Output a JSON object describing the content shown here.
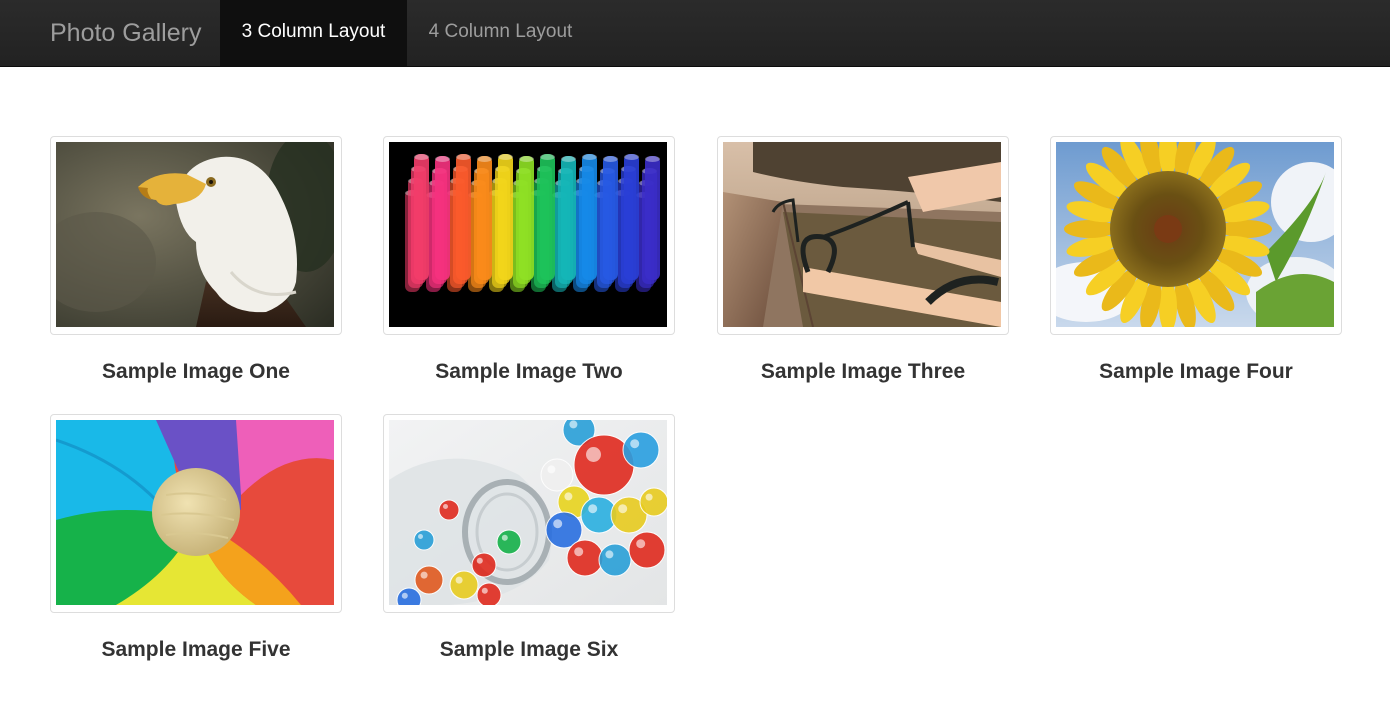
{
  "navbar": {
    "brand": "Photo Gallery",
    "items": [
      {
        "label": "3 Column Layout",
        "active": true
      },
      {
        "label": "4 Column Layout",
        "active": false
      }
    ]
  },
  "gallery": {
    "items": [
      {
        "caption": "Sample Image One",
        "image": "bald-eagle-photo"
      },
      {
        "caption": "Sample Image Two",
        "image": "colorful-tubes-photo"
      },
      {
        "caption": "Sample Image Three",
        "image": "park-bench-photo"
      },
      {
        "caption": "Sample Image Four",
        "image": "sunflower-photo"
      },
      {
        "caption": "Sample Image Five",
        "image": "pinwheel-photo"
      },
      {
        "caption": "Sample Image Six",
        "image": "glass-marbles-photo"
      }
    ]
  },
  "colors": {
    "navbar_bg": "#222222",
    "nav_active_bg": "#0f0f0f",
    "nav_text": "#9d9d9d",
    "caption_text": "#333333"
  }
}
